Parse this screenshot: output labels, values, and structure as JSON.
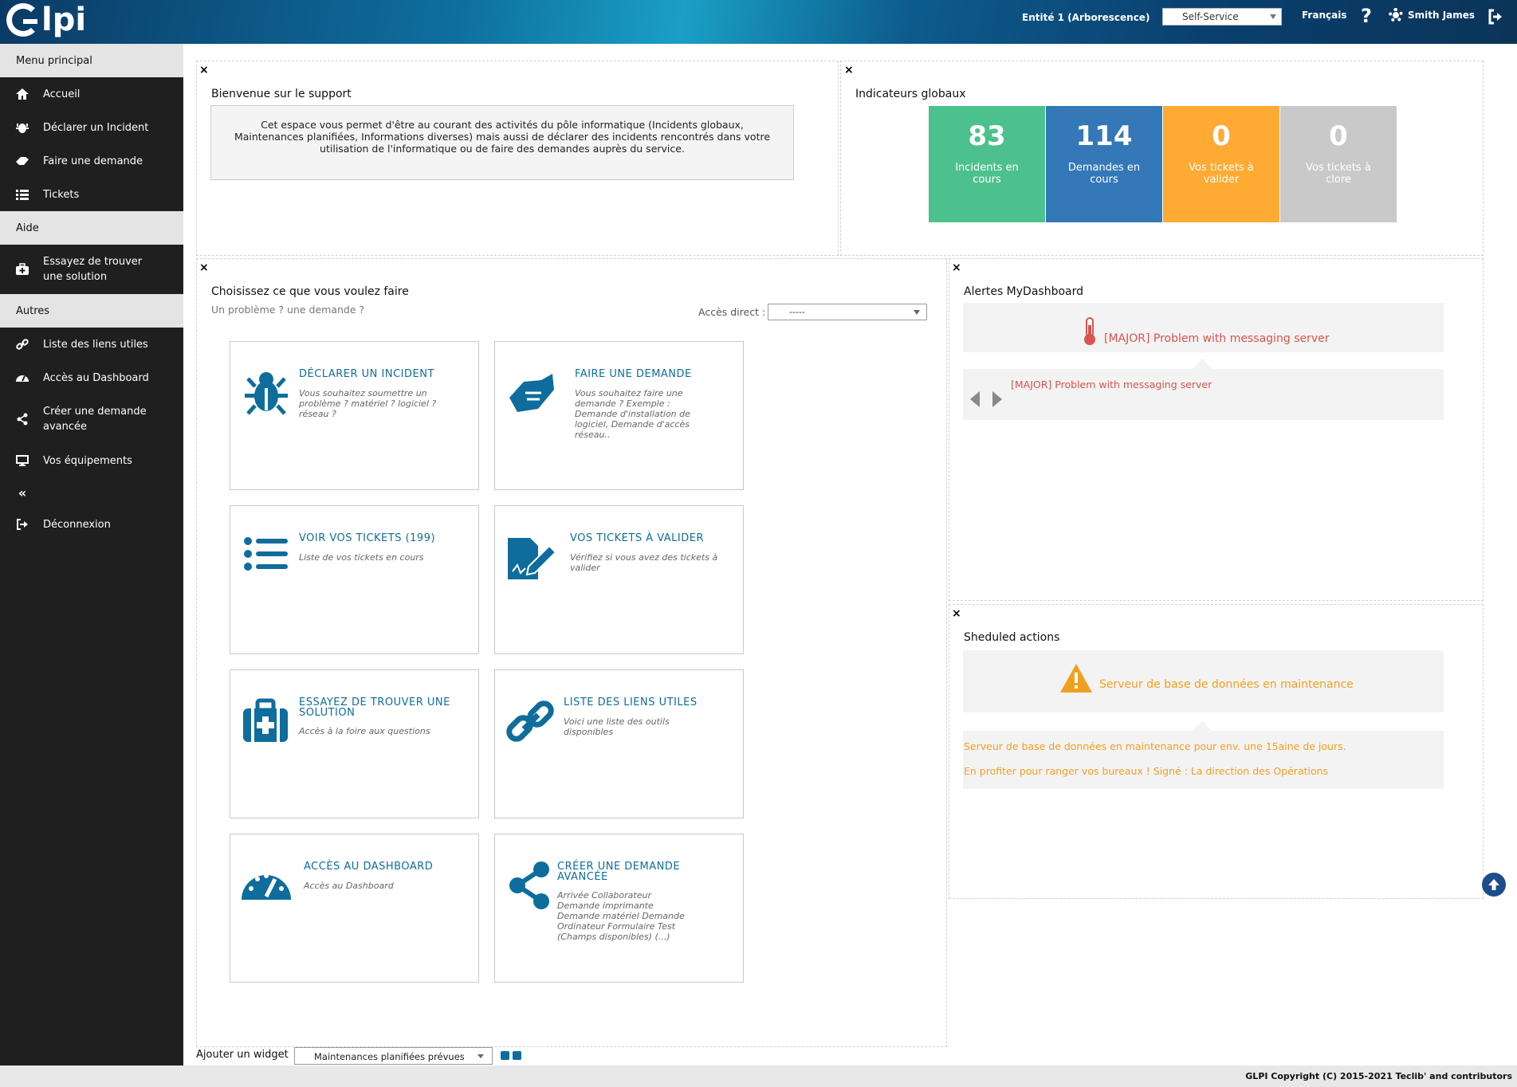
{
  "header": {
    "logo_text": "lpi",
    "entity": "Entité 1 (Arborescence)",
    "profile": "Self-Service",
    "language": "Français",
    "help_label": "?",
    "user_name": "Smith James"
  },
  "sidebar": {
    "sections": [
      {
        "title": "Menu principal",
        "items": [
          {
            "label": "Accueil",
            "icon": "home-icon"
          },
          {
            "label": "Déclarer un Incident",
            "icon": "bug-icon"
          },
          {
            "label": "Faire une demande",
            "icon": "handshake-icon"
          },
          {
            "label": "Tickets",
            "icon": "list-icon"
          }
        ]
      },
      {
        "title": "Aide",
        "items": [
          {
            "label": "Essayez de trouver une solution",
            "icon": "medkit-icon"
          }
        ]
      },
      {
        "title": "Autres",
        "items": [
          {
            "label": "Liste des liens utiles",
            "icon": "link-icon"
          },
          {
            "label": "Accès au Dashboard",
            "icon": "tachometer-icon"
          },
          {
            "label": "Créer une demande avancée",
            "icon": "share-icon"
          },
          {
            "label": "Vos équipements",
            "icon": "desktop-icon"
          },
          {
            "label": "",
            "icon": "collapse-icon"
          },
          {
            "label": "Déconnexion",
            "icon": "sign-out-icon"
          }
        ]
      }
    ],
    "collapse_glyph": "«"
  },
  "widgets": {
    "close_glyph": "×",
    "welcome": {
      "title": "Bienvenue sur le support",
      "text": "Cet espace vous permet d'être au courant des activités du pôle informatique (Incidents globaux, Maintenances planifiées, Informations diverses) mais aussi de déclarer des incidents rencontrés dans votre utilisation de l'informatique ou de faire des demandes auprès du service."
    },
    "indicators": {
      "title": "Indicateurs globaux",
      "items": [
        {
          "value": "83",
          "label": "Incidents en cours",
          "color": "#4cc18e"
        },
        {
          "value": "114",
          "label": "Demandes en cours",
          "color": "#3478b8"
        },
        {
          "value": "0",
          "label": "Vos tickets à valider",
          "color": "#ffaa33"
        },
        {
          "value": "0",
          "label": "Vos tickets à clore",
          "color": "#c9c9c9"
        }
      ]
    },
    "choose": {
      "title": "Choisissez ce que vous voulez faire",
      "subtitle": "Un problème ? une demande ?",
      "direct_access_label": "Accès direct :",
      "direct_access_value": "-----",
      "cards": [
        {
          "title": "DÉCLARER UN INCIDENT",
          "desc": "Vous souhaitez soumettre un problème ? matériel ? logiciel ? réseau ?",
          "icon": "bug-icon"
        },
        {
          "title": "FAIRE UNE DEMANDE",
          "desc": "Vous souhaitez faire une demande ? Exemple : Demande d'installation de logiciel, Demande d'accès réseau..",
          "icon": "handshake-icon"
        },
        {
          "title": "VOIR VOS TICKETS (199)",
          "desc": "Liste de vos tickets en cours",
          "icon": "list-icon"
        },
        {
          "title": "VOS TICKETS À VALIDER",
          "desc": "Vérifiez si vous avez des tickets à valider",
          "icon": "signature-icon"
        },
        {
          "title": "ESSAYEZ DE TROUVER UNE SOLUTION",
          "desc": "Accès à la foire aux questions",
          "icon": "medkit-icon"
        },
        {
          "title": "LISTE DES LIENS UTILES",
          "desc": "Voici une liste des outils disponibles",
          "icon": "link-icon"
        },
        {
          "title": "ACCÈS AU DASHBOARD",
          "desc": "Accès au Dashboard",
          "icon": "tachometer-icon"
        },
        {
          "title": "CRÉER UNE DEMANDE AVANCÉE",
          "desc": "Arrivée Collaborateur Demande imprimante Demande matériel Demande Ordinateur Formulaire Test (Champs disponibles) (...)",
          "icon": "share-icon"
        }
      ]
    },
    "alerts": {
      "title": "Alertes MyDashboard",
      "headline": "[MAJOR] Problem with messaging server",
      "item": "[MAJOR] Problem with messaging server",
      "color": "#d9534f"
    },
    "scheduled": {
      "title": "Sheduled actions",
      "headline": "Serveur de base de données en maintenance",
      "line1": "Serveur de base de données en maintenance pour env. une 15aine de jours.",
      "line2": "En profiter pour ranger vos bureaux ! Signé : La direction des Opérations",
      "color": "#f0a020"
    }
  },
  "add_widget": {
    "label": "Ajouter un widget",
    "selected": "Maintenances planifiées prévues"
  },
  "footer": {
    "text": "GLPI Copyright (C) 2015-2021 Teclib' and contributors"
  }
}
